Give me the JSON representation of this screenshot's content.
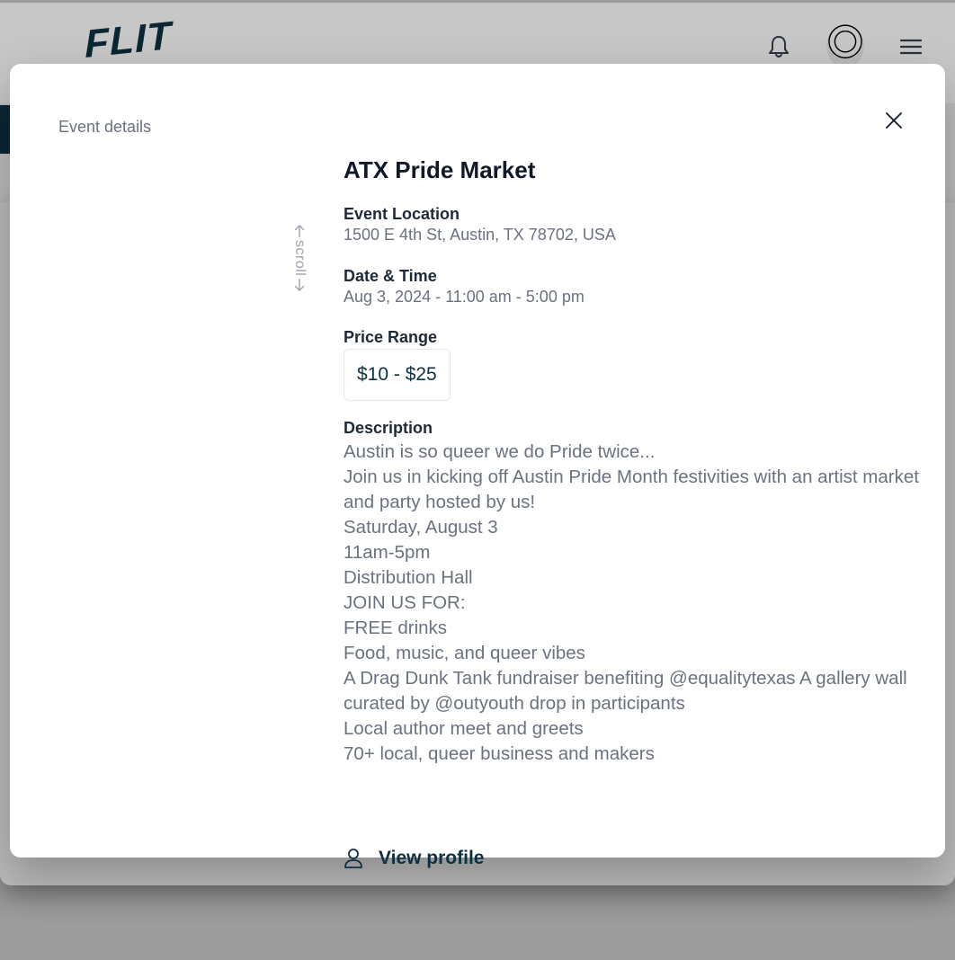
{
  "app": {
    "logo_text": "FLIT"
  },
  "modal": {
    "heading": "Event details",
    "scroll_hint": "scroll",
    "event": {
      "title": "ATX Pride Market",
      "location_label": "Event Location",
      "location_value": "1500 E 4th St, Austin, TX 78702, USA",
      "datetime_label": "Date & Time",
      "datetime_value": "Aug 3, 2024 - 11:00 am - 5:00 pm",
      "price_label": "Price Range",
      "price_value": "$10 - $25",
      "description_label": "Description",
      "description_lines": [
        "Austin is so queer we do Pride twice...",
        "Join us in kicking off Austin Pride Month festivities with an artist market and party hosted by us!",
        "Saturday, August 3",
        "11am-5pm",
        "Distribution Hall",
        "JOIN US FOR:",
        "FREE drinks",
        "Food, music, and queer vibes",
        "A Drag Dunk Tank fundraiser benefiting @equalitytexas A gallery wall curated by @outyouth drop in participants",
        "Local author meet and greets",
        "70+ local, queer business and makers"
      ]
    },
    "view_profile_label": "View profile"
  },
  "icons": {
    "bell": "bell-icon",
    "avatar": "avatar",
    "menu": "hamburger-menu-icon",
    "close": "close-icon",
    "scroll_up": "arrow-up-icon",
    "scroll_down": "arrow-down-icon",
    "profile": "user-icon"
  },
  "colors": {
    "brand": "#0d3140",
    "muted_text": "#6b7280",
    "heading_text": "#111827"
  }
}
